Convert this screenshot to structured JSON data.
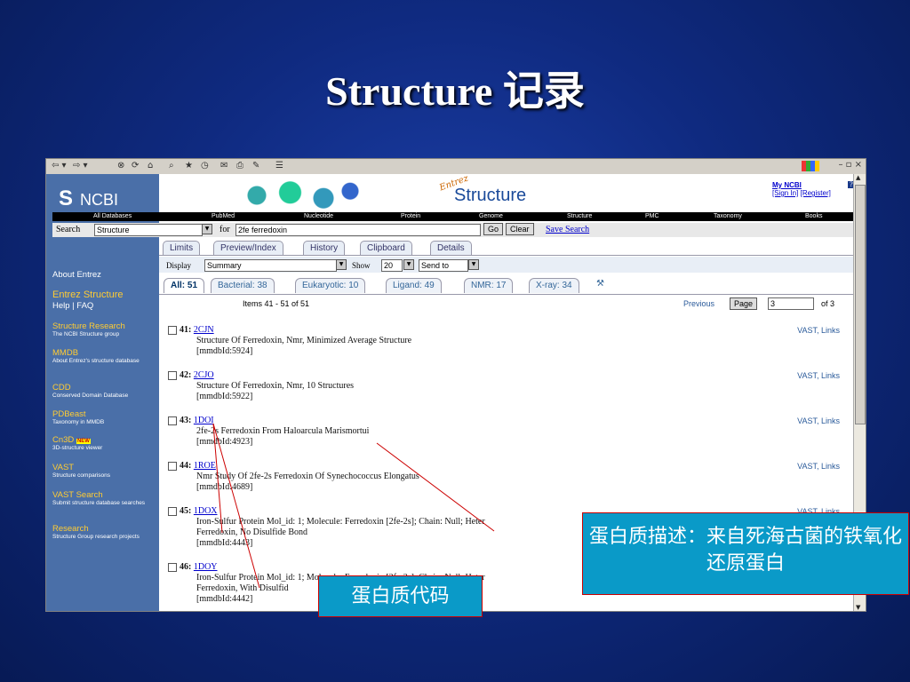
{
  "slide": {
    "title": "Structure 记录"
  },
  "sidebar": {
    "logo": "NCBI",
    "items": [
      {
        "title": "About Entrez",
        "desc": ""
      },
      {
        "title": "Entrez Structure",
        "desc": ""
      },
      {
        "title": "Help | FAQ",
        "desc": ""
      },
      {
        "title": "Structure Research",
        "desc": "The NCBI Structure group"
      },
      {
        "title": "MMDB",
        "desc": "About Entrez's structure database"
      },
      {
        "title": "CDD",
        "desc": "Conserved Domain Database"
      },
      {
        "title": "PDBeast",
        "desc": "Taxonomy in MMDB"
      },
      {
        "title": "Cn3D",
        "desc": "3D-structure viewer",
        "badge": "NEW"
      },
      {
        "title": "VAST",
        "desc": "Structure comparisons"
      },
      {
        "title": "VAST Search",
        "desc": "Submit structure database searches"
      },
      {
        "title": "Research",
        "desc": "Structure Group research projects"
      }
    ]
  },
  "banner": {
    "entrez": "Entrez",
    "title": "Structure",
    "my_ncbi": "My NCBI",
    "help_q": "?",
    "sign_in": "[Sign In]",
    "register": "[Register]"
  },
  "navbar": [
    "All Databases",
    "PubMed",
    "Nucleotide",
    "Protein",
    "Genome",
    "Structure",
    "PMC",
    "Taxonomy",
    "Books"
  ],
  "search": {
    "label": "Search",
    "db": "Structure",
    "for_label": "for",
    "query": "2fe ferredoxin",
    "go": "Go",
    "clear": "Clear",
    "save": "Save Search"
  },
  "tabs": [
    "Limits",
    "Preview/Index",
    "History",
    "Clipboard",
    "Details"
  ],
  "display": {
    "display_label": "Display",
    "display_value": "Summary",
    "show_label": "Show",
    "show_value": "20",
    "send_to": "Send to"
  },
  "result_tabs": [
    {
      "label": "All: 51",
      "active": true
    },
    {
      "label": "Bacterial: 38"
    },
    {
      "label": "Eukaryotic: 10"
    },
    {
      "label": "Ligand: 49"
    },
    {
      "label": "NMR: 17"
    },
    {
      "label": "X-ray: 34"
    }
  ],
  "paging": {
    "items": "Items 41 - 51 of 51",
    "previous": "Previous",
    "page_btn": "Page",
    "page_value": "3",
    "of": "of 3"
  },
  "entries": [
    {
      "num": "41:",
      "id": "2CJN",
      "desc": "Structure Of Ferredoxin, Nmr, Minimized Average Structure",
      "mmdb": "[mmdbId:5924]",
      "links": "VAST, Links"
    },
    {
      "num": "42:",
      "id": "2CJO",
      "desc": "Structure Of Ferredoxin, Nmr, 10 Structures",
      "mmdb": "[mmdbId:5922]",
      "links": "VAST, Links"
    },
    {
      "num": "43:",
      "id": "1DOI",
      "desc": "2fe-2s Ferredoxin From Haloarcula Marismortui",
      "mmdb": "[mmdbId:4923]",
      "links": "VAST, Links"
    },
    {
      "num": "44:",
      "id": "1ROE",
      "desc": "Nmr Study Of 2fe-2s Ferredoxin Of Synechococcus Elongatus",
      "mmdb": "[mmdbId:4689]",
      "links": "VAST, Links"
    },
    {
      "num": "45:",
      "id": "1DOX",
      "desc": "Iron-Sulfur Protein Mol_id: 1; Molecule: Ferredoxin [2fe-2s]; Chain: Null; Heter",
      "desc2": "Ferredoxin, No Disulfide Bond",
      "mmdb": "[mmdbId:4443]",
      "links": "VAST, Links"
    },
    {
      "num": "46:",
      "id": "1DOY",
      "desc": "Iron-Sulfur Protein Mol_id: 1; Molecule: Ferredoxin [2fe-2s]; Chain: Null; Heter",
      "desc2": "Ferredoxin, With Disulfid",
      "mmdb": "[mmdbId:4442]",
      "links": ""
    }
  ],
  "callouts": {
    "description": "蛋白质描述：来自死海古菌的铁氧化还原蛋白",
    "code": "蛋白质代码"
  },
  "colors": {
    "background": "#0f2a80",
    "sidebar": "#4a6fa8",
    "callout": "#0a9ac8",
    "line": "#cc0000"
  }
}
